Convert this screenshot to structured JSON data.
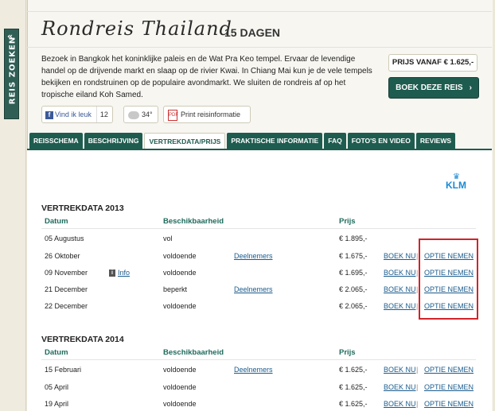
{
  "sidebar": {
    "label": "REIS ZOEKEN",
    "arrow": "«"
  },
  "header": {
    "title": "Rondreis Thailand",
    "days": "15 DAGEN",
    "description": "Bezoek in Bangkok het koninklijke paleis en de Wat Pra Keo tempel. Ervaar de levendige handel op de drijvende markt en slaap op de rivier Kwai. In Chiang Mai kun je de vele tempels bekijken en rondstruinen op de populaire avondmarkt. We sluiten de rondreis af op het tropische eiland Koh Samed.",
    "price": "PRIJS VANAF € 1.625,-",
    "book_button": "BOEK DEZE REIS",
    "book_chevron": "›"
  },
  "actions": {
    "fb_label": "Vind ik leuk",
    "fb_count": "12",
    "weather": "34°",
    "print_label": "Print reisinformatie"
  },
  "tabs": [
    {
      "label": "REISSCHEMA"
    },
    {
      "label": "BESCHRIJVING"
    },
    {
      "label": "VERTREKDATA/PRIJS"
    },
    {
      "label": "PRAKTISCHE INFORMATIE"
    },
    {
      "label": "FAQ"
    },
    {
      "label": "FOTO'S EN VIDEO"
    },
    {
      "label": "REVIEWS"
    }
  ],
  "active_tab": "VERTREKDATA/PRIJS",
  "airline": "KLM",
  "columns": {
    "date": "Datum",
    "availability": "Beschikbaarheid",
    "price": "Prijs"
  },
  "links": {
    "participants": "Deelnemers",
    "book": "BOEK NU",
    "option": "OPTIE NEMEN",
    "info": "Info",
    "sep": "|"
  },
  "sections": [
    {
      "title": "VERTREKDATA 2013",
      "rows": [
        {
          "date": "05 Augustus",
          "availability": "vol",
          "price": "€ 1.895,-",
          "info": false,
          "participants": false,
          "book": false
        },
        {
          "date": "26 Oktober",
          "availability": "voldoende",
          "price": "€ 1.675,-",
          "info": false,
          "participants": true,
          "book": true
        },
        {
          "date": "09 November",
          "availability": "voldoende",
          "price": "€ 1.695,-",
          "info": true,
          "participants": false,
          "book": true
        },
        {
          "date": "21 December",
          "availability": "beperkt",
          "price": "€ 2.065,-",
          "info": false,
          "participants": true,
          "book": true
        },
        {
          "date": "22 December",
          "availability": "voldoende",
          "price": "€ 2.065,-",
          "info": false,
          "participants": false,
          "book": true
        }
      ]
    },
    {
      "title": "VERTREKDATA 2014",
      "rows": [
        {
          "date": "15 Februari",
          "availability": "voldoende",
          "price": "€ 1.625,-",
          "participants": true
        },
        {
          "date": "05 April",
          "availability": "voldoende",
          "price": "€ 1.625,-",
          "participants": false
        },
        {
          "date": "19 April",
          "availability": "voldoende",
          "price": "€ 1.625,-",
          "participants": false
        }
      ]
    }
  ],
  "colors": {
    "brand_green": "#1f5c50",
    "highlight_red": "#d0232a",
    "link_blue": "#1a5b8c",
    "klm_blue": "#1a8ad4"
  }
}
